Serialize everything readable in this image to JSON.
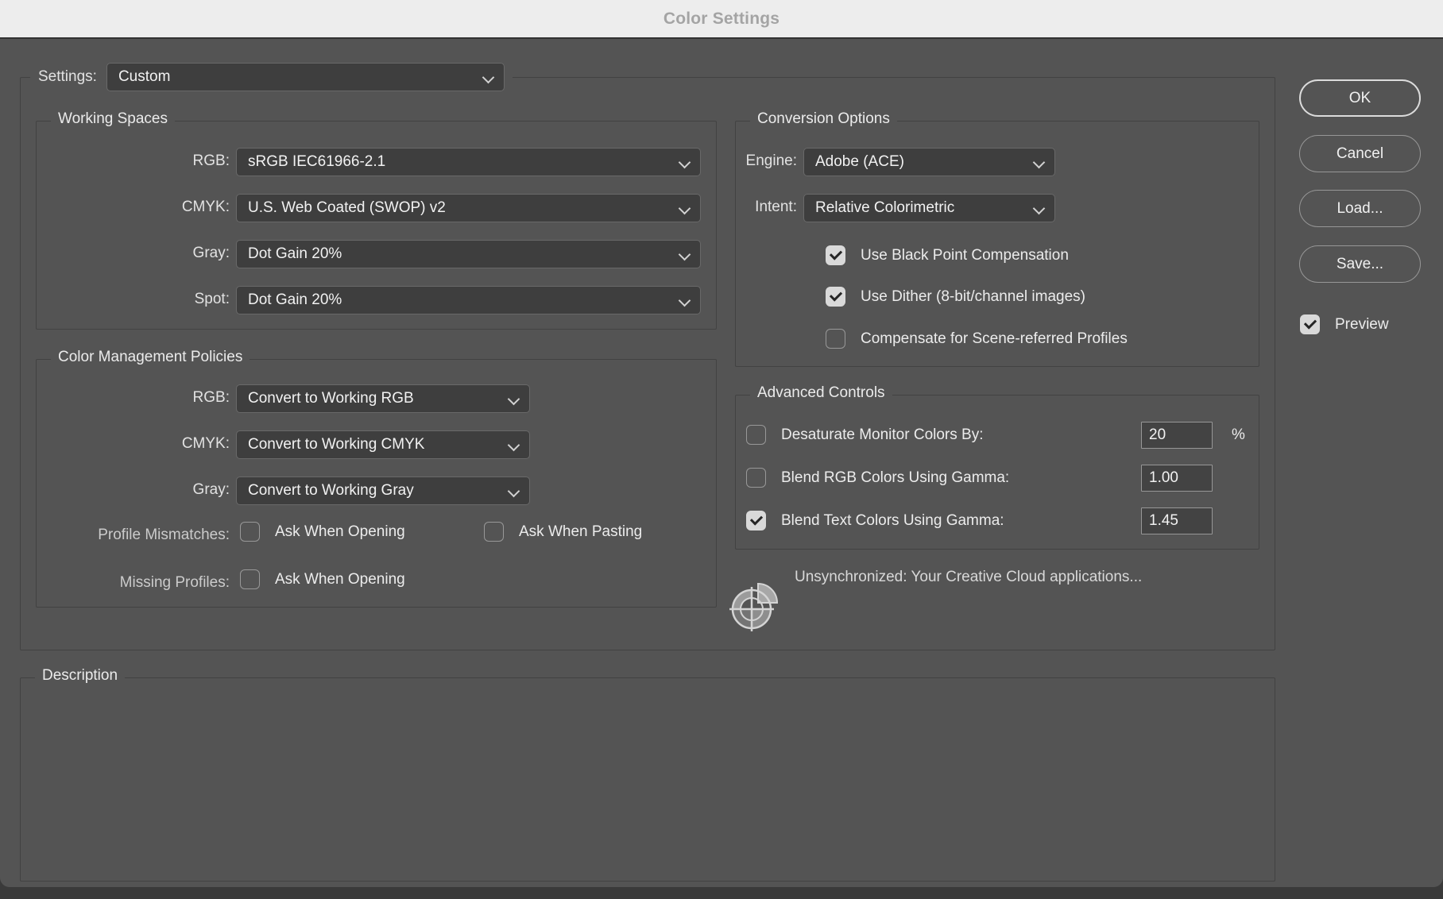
{
  "window": {
    "title": "Color Settings"
  },
  "colors": {
    "titlebar_bg": "#ededed",
    "dialog_bg": "#545454",
    "control_bg": "#3e3e3e",
    "checkbox_checked_bg": "#d9d9d9",
    "text": "#ececec"
  },
  "settings": {
    "label": "Settings:",
    "value": "Custom"
  },
  "working_spaces": {
    "title": "Working Spaces",
    "rows": [
      {
        "label": "RGB:",
        "value": "sRGB IEC61966-2.1"
      },
      {
        "label": "CMYK:",
        "value": "U.S. Web Coated (SWOP) v2"
      },
      {
        "label": "Gray:",
        "value": "Dot Gain 20%"
      },
      {
        "label": "Spot:",
        "value": "Dot Gain 20%"
      }
    ]
  },
  "color_management": {
    "title": "Color Management Policies",
    "rows": [
      {
        "label": "RGB:",
        "value": "Convert to Working RGB"
      },
      {
        "label": "CMYK:",
        "value": "Convert to Working CMYK"
      },
      {
        "label": "Gray:",
        "value": "Convert to Working Gray"
      }
    ],
    "profile_mismatches": {
      "label": "Profile Mismatches:",
      "ask_opening": {
        "label": "Ask When Opening",
        "checked": false
      },
      "ask_pasting": {
        "label": "Ask When Pasting",
        "checked": false
      }
    },
    "missing_profiles": {
      "label": "Missing Profiles:",
      "ask_opening": {
        "label": "Ask When Opening",
        "checked": false
      }
    }
  },
  "conversion_options": {
    "title": "Conversion Options",
    "engine": {
      "label": "Engine:",
      "value": "Adobe (ACE)"
    },
    "intent": {
      "label": "Intent:",
      "value": "Relative Colorimetric"
    },
    "checkboxes": [
      {
        "label": "Use Black Point Compensation",
        "checked": true
      },
      {
        "label": "Use Dither (8-bit/channel images)",
        "checked": true
      },
      {
        "label": "Compensate for Scene-referred Profiles",
        "checked": false
      }
    ]
  },
  "advanced_controls": {
    "title": "Advanced Controls",
    "rows": [
      {
        "label": "Desaturate Monitor Colors By:",
        "checked": false,
        "value": "20",
        "suffix": "%"
      },
      {
        "label": "Blend RGB Colors Using Gamma:",
        "checked": false,
        "value": "1.00",
        "suffix": ""
      },
      {
        "label": "Blend Text Colors Using Gamma:",
        "checked": true,
        "value": "1.45",
        "suffix": ""
      }
    ]
  },
  "sync_status": {
    "icon": "color-sync-icon",
    "text": "Unsynchronized: Your Creative Cloud applications..."
  },
  "description": {
    "title": "Description",
    "content": ""
  },
  "buttons": [
    {
      "label": "OK",
      "default": true
    },
    {
      "label": "Cancel"
    },
    {
      "label": "Load..."
    },
    {
      "label": "Save..."
    }
  ],
  "preview": {
    "label": "Preview",
    "checked": true
  }
}
